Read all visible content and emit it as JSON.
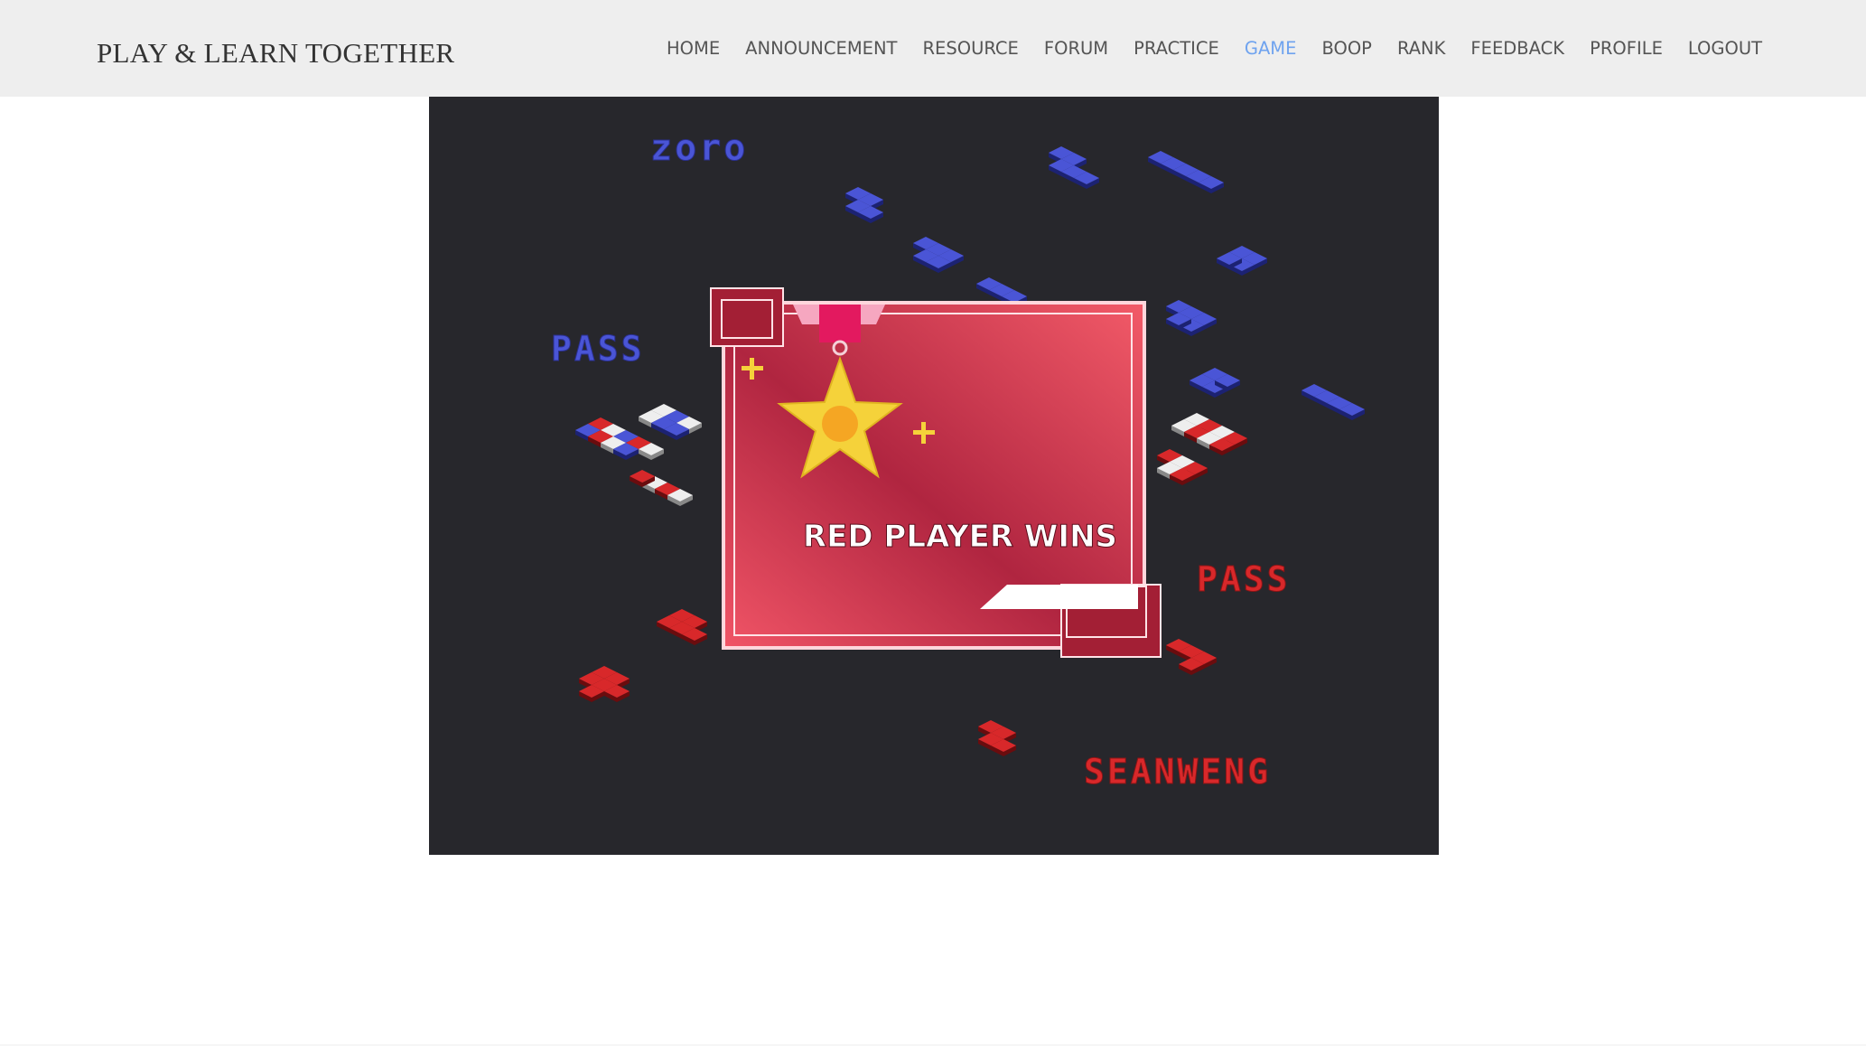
{
  "brand": "PLAY & LEARN TOGETHER",
  "nav": [
    {
      "label": "HOME",
      "active": false
    },
    {
      "label": "ANNOUNCEMENT",
      "active": false
    },
    {
      "label": "RESOURCE",
      "active": false
    },
    {
      "label": "FORUM",
      "active": false
    },
    {
      "label": "PRACTICE",
      "active": false
    },
    {
      "label": "GAME",
      "active": true
    },
    {
      "label": "BOOP",
      "active": false
    },
    {
      "label": "RANK",
      "active": false
    },
    {
      "label": "FEEDBACK",
      "active": false
    },
    {
      "label": "PROFILE",
      "active": false
    },
    {
      "label": "LOGOUT",
      "active": false
    }
  ],
  "game": {
    "blue_player_name": "zoro",
    "blue_pass_label": "PASS",
    "red_pass_label": "PASS",
    "red_player_name": "SEANWENG",
    "result_text": "RED PLAYER WINS",
    "colors": {
      "background": "#27272c",
      "blue": "#4a55d6",
      "red": "#d8282a",
      "card": "#c8304a",
      "star": "#f5d23a",
      "nav_active": "#6fa3ef"
    }
  }
}
